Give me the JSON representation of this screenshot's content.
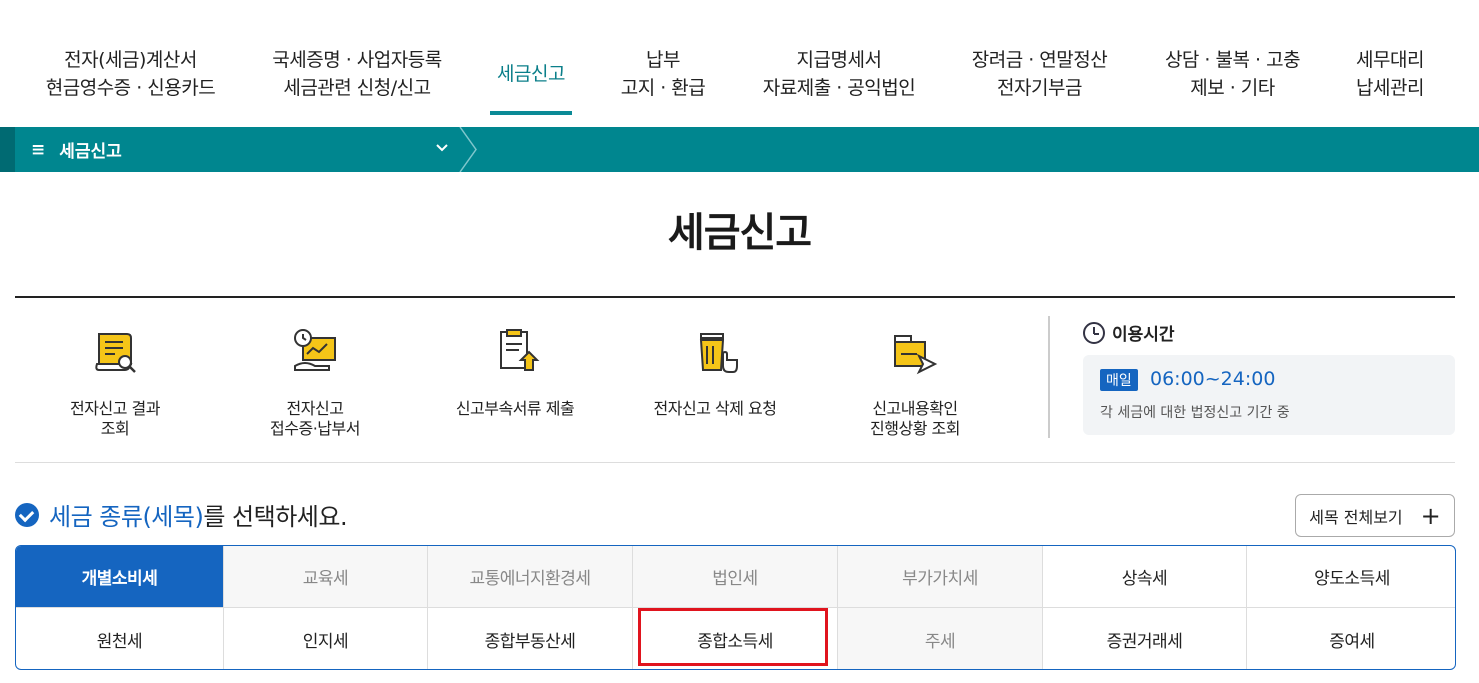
{
  "nav": [
    {
      "line1": "전자(세금)계산서",
      "line2": "현금영수증 · 신용카드"
    },
    {
      "line1": "국세증명 · 사업자등록",
      "line2": "세금관련 신청/신고"
    },
    {
      "line1": "세금신고",
      "line2": ""
    },
    {
      "line1": "납부",
      "line2": "고지 · 환급"
    },
    {
      "line1": "지급명세서",
      "line2": "자료제출 · 공익법인"
    },
    {
      "line1": "장려금 · 연말정산",
      "line2": "전자기부금"
    },
    {
      "line1": "상담 · 불복 · 고충",
      "line2": "제보 · 기타"
    },
    {
      "line1": "세무대리",
      "line2": "납세관리"
    }
  ],
  "breadcrumb": {
    "menu_icon": "≡",
    "label": "세금신고",
    "chevron": "⌄"
  },
  "page_title": "세금신고",
  "quick": [
    {
      "line1": "전자신고 결과",
      "line2": "조회",
      "icon": "document-search-icon"
    },
    {
      "line1": "전자신고",
      "line2": "접수증·납부서",
      "icon": "receipt-clock-icon"
    },
    {
      "line1": "신고부속서류 제출",
      "line2": "",
      "icon": "document-upload-icon"
    },
    {
      "line1": "전자신고 삭제 요청",
      "line2": "",
      "icon": "trash-click-icon"
    },
    {
      "line1": "신고내용확인",
      "line2": "진행상황 조회",
      "icon": "folder-send-icon"
    }
  ],
  "hours": {
    "title": "이용시간",
    "badge": "매일",
    "time": "06:00~24:00",
    "desc": "각 세금에 대한 법정신고 기간 중"
  },
  "section": {
    "highlight": "세금 종류(세목)",
    "rest": "를 선택하세요."
  },
  "view_all": {
    "label": "세목 전체보기",
    "plus": "+"
  },
  "taxes_row1": [
    {
      "label": "개별소비세",
      "state": "selected"
    },
    {
      "label": "교육세",
      "state": "disabled"
    },
    {
      "label": "교통에너지환경세",
      "state": "disabled"
    },
    {
      "label": "법인세",
      "state": "disabled"
    },
    {
      "label": "부가가치세",
      "state": "disabled"
    },
    {
      "label": "상속세",
      "state": "normal"
    },
    {
      "label": "양도소득세",
      "state": "normal"
    }
  ],
  "taxes_row2": [
    {
      "label": "원천세",
      "state": "normal"
    },
    {
      "label": "인지세",
      "state": "normal"
    },
    {
      "label": "종합부동산세",
      "state": "normal"
    },
    {
      "label": "종합소득세",
      "state": "normal"
    },
    {
      "label": "주세",
      "state": "disabled"
    },
    {
      "label": "증권거래세",
      "state": "normal"
    },
    {
      "label": "증여세",
      "state": "normal"
    }
  ],
  "colors": {
    "teal": "#00868f",
    "blue": "#1565c0",
    "highlight": "#e0141e",
    "icon_yellow": "#f5c518"
  }
}
